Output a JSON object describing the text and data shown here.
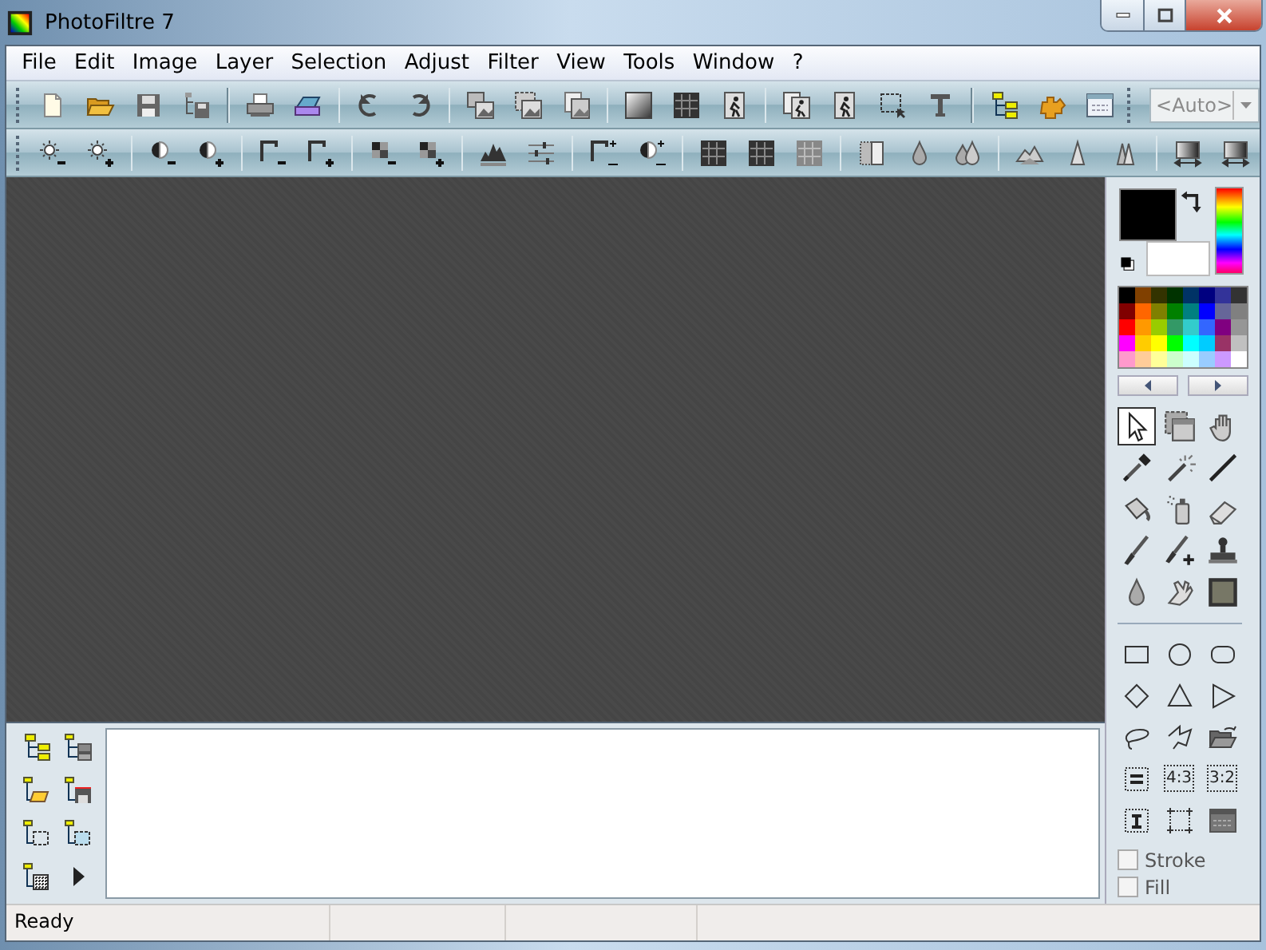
{
  "window": {
    "title": "PhotoFiltre 7"
  },
  "menu": [
    {
      "label": "File"
    },
    {
      "label": "Edit"
    },
    {
      "label": "Image"
    },
    {
      "label": "Layer"
    },
    {
      "label": "Selection"
    },
    {
      "label": "Adjust"
    },
    {
      "label": "Filter"
    },
    {
      "label": "View"
    },
    {
      "label": "Tools"
    },
    {
      "label": "Window"
    },
    {
      "label": "?"
    }
  ],
  "zoom_combo": {
    "value": "<Auto>",
    "disabled": true
  },
  "colors": {
    "foreground": {
      "color": "#000000"
    },
    "background": {
      "color": "#ffffff"
    },
    "palette": [
      {
        "color": "#000000"
      },
      {
        "color": "#804000"
      },
      {
        "color": "#333300"
      },
      {
        "color": "#003300"
      },
      {
        "color": "#003366"
      },
      {
        "color": "#000080"
      },
      {
        "color": "#333399"
      },
      {
        "color": "#333333"
      },
      {
        "color": "#800000"
      },
      {
        "color": "#ff6600"
      },
      {
        "color": "#808000"
      },
      {
        "color": "#008000"
      },
      {
        "color": "#008080"
      },
      {
        "color": "#0000ff"
      },
      {
        "color": "#666699"
      },
      {
        "color": "#808080"
      },
      {
        "color": "#ff0000"
      },
      {
        "color": "#ff9900"
      },
      {
        "color": "#99cc00"
      },
      {
        "color": "#339966"
      },
      {
        "color": "#33cccc"
      },
      {
        "color": "#3366ff"
      },
      {
        "color": "#800080"
      },
      {
        "color": "#969696"
      },
      {
        "color": "#ff00ff"
      },
      {
        "color": "#ffcc00"
      },
      {
        "color": "#ffff00"
      },
      {
        "color": "#00ff00"
      },
      {
        "color": "#00ffff"
      },
      {
        "color": "#00ccff"
      },
      {
        "color": "#993366"
      },
      {
        "color": "#c0c0c0"
      },
      {
        "color": "#ff99cc"
      },
      {
        "color": "#ffcc99"
      },
      {
        "color": "#ffff99"
      },
      {
        "color": "#ccffcc"
      },
      {
        "color": "#ccffff"
      },
      {
        "color": "#99ccff"
      },
      {
        "color": "#cc99ff"
      },
      {
        "color": "#ffffff"
      }
    ]
  },
  "tools": [
    {
      "selected": true
    },
    {
      "selected": false
    },
    {
      "selected": false
    },
    {
      "selected": false
    },
    {
      "selected": false
    },
    {
      "selected": false
    },
    {
      "selected": false
    },
    {
      "selected": false
    },
    {
      "selected": false
    },
    {
      "selected": false
    },
    {
      "selected": false
    },
    {
      "selected": false
    },
    {
      "selected": false
    },
    {
      "selected": false
    },
    {
      "selected": false
    }
  ],
  "selection_presets": [
    {
      "label": "4:3"
    },
    {
      "label": "3:2"
    }
  ],
  "shape_options": [
    {
      "label": "Stroke",
      "checked": false
    },
    {
      "label": "Fill",
      "checked": false
    }
  ],
  "status_bar": {
    "text": "Ready"
  }
}
